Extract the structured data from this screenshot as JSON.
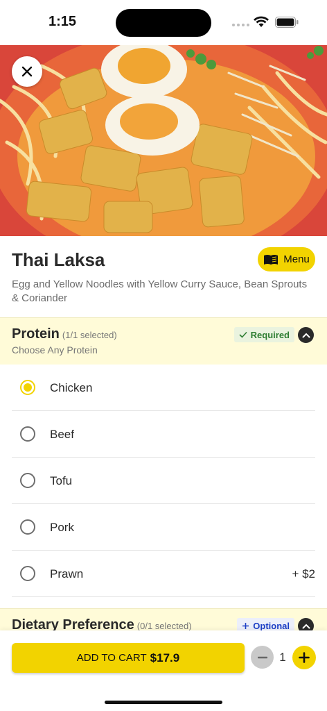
{
  "status_bar": {
    "time": "1:15"
  },
  "hero": {
    "image_alt": "Thai Laksa noodle soup with boiled eggs"
  },
  "item": {
    "title": "Thai Laksa",
    "menu_label": "Menu",
    "description": "Egg and Yellow Noodles with Yellow Curry Sauce, Bean Sprouts & Coriander"
  },
  "sections": [
    {
      "title": "Protein",
      "count": "(1/1 selected)",
      "subtitle": "Choose Any Protein",
      "badge": "Required",
      "options": [
        {
          "label": "Chicken",
          "price": "",
          "selected": true
        },
        {
          "label": "Beef",
          "price": "",
          "selected": false
        },
        {
          "label": "Tofu",
          "price": "",
          "selected": false
        },
        {
          "label": "Pork",
          "price": "",
          "selected": false
        },
        {
          "label": "Prawn",
          "price": "+ $2",
          "selected": false
        }
      ]
    },
    {
      "title": "Dietary Preference",
      "count": "(0/1 selected)",
      "badge": "Optional"
    }
  ],
  "cart": {
    "add_label": "ADD TO CART",
    "price": "$17.9",
    "quantity": "1"
  },
  "colors": {
    "accent": "#f2d300",
    "section_bg": "#fffbd8",
    "required_green": "#2e7d32",
    "optional_blue": "#1d3fc6"
  }
}
